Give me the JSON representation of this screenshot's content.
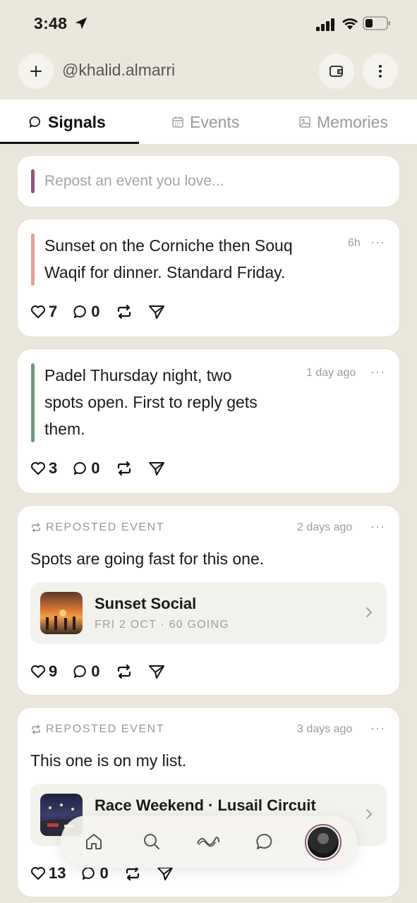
{
  "status_bar": {
    "time": "3:48"
  },
  "header": {
    "handle": "@khalid.almarri"
  },
  "tabs": [
    {
      "label": "Signals",
      "active": true
    },
    {
      "label": "Events",
      "active": false
    },
    {
      "label": "Memories",
      "active": false
    }
  ],
  "composer": {
    "placeholder": "Repost an event you love..."
  },
  "posts": [
    {
      "text_line1": "Sunset on the Corniche then Souq",
      "text_line2": "Waqif for dinner. Standard Friday.",
      "time": "6h",
      "likes": "7",
      "comments": "0",
      "accent": "#e3a39c"
    },
    {
      "text_line1": "Padel Thursday night, two",
      "text_line2": "spots open. First to reply gets",
      "text_line3": "them.",
      "time": "1 day ago",
      "likes": "3",
      "comments": "0",
      "accent": "#6f9a7c"
    }
  ],
  "reposts": [
    {
      "label": "REPOSTED EVENT",
      "time": "2 days ago",
      "text": "Spots are going fast for this one.",
      "event_title": "Sunset Social",
      "event_sub": "FRI 2 OCT · 60 GOING",
      "likes": "9",
      "comments": "0"
    },
    {
      "label": "REPOSTED EVENT",
      "time": "3 days ago",
      "text": "This one is on my list.",
      "event_title": "Race Weekend · Lusail Circuit",
      "likes": "13",
      "comments": "0"
    }
  ],
  "more_glyph": "···",
  "colors": {
    "background": "#ebe7dd",
    "accent_purple": "#8b5a7a"
  },
  "nav_icons": [
    "home-icon",
    "search-icon",
    "wave-icon",
    "chat-icon",
    "profile-avatar"
  ]
}
